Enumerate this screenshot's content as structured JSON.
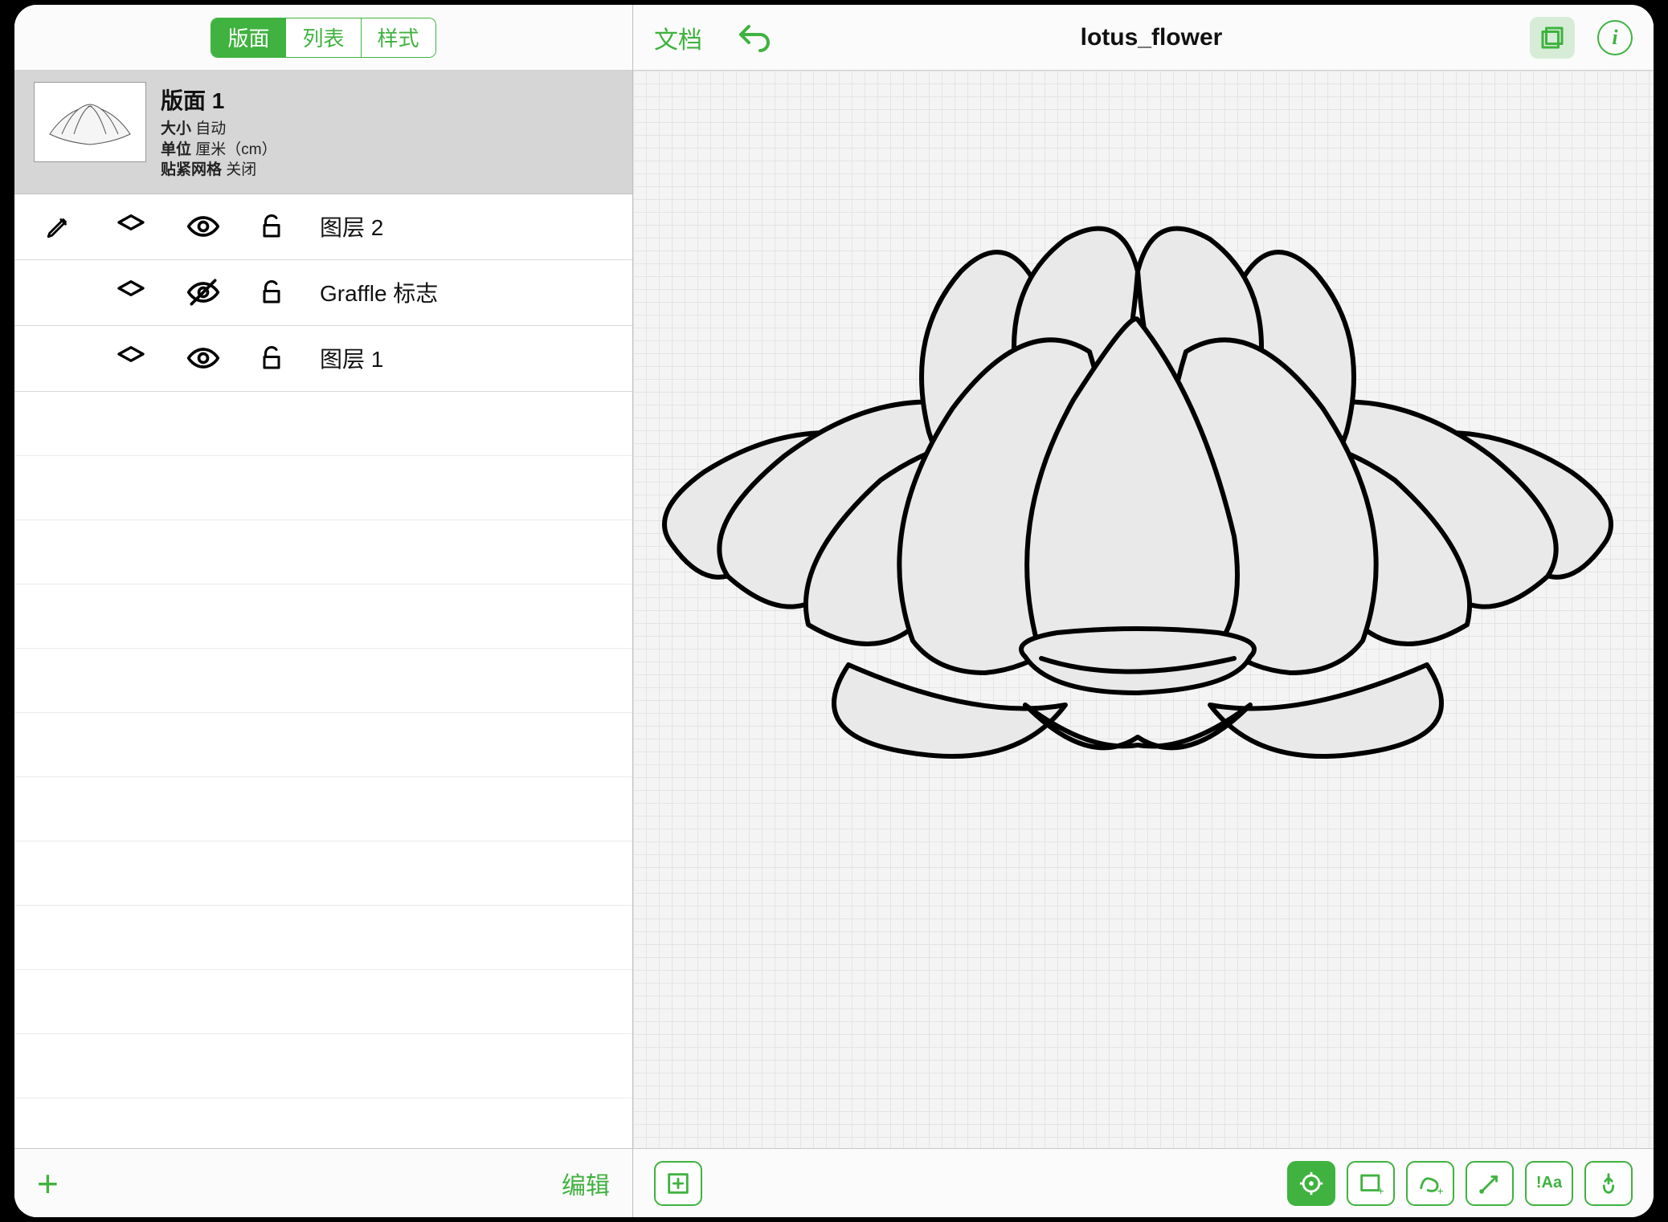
{
  "sidebar": {
    "tabs": [
      {
        "label": "版面",
        "active": true
      },
      {
        "label": "列表",
        "active": false
      },
      {
        "label": "样式",
        "active": false
      }
    ],
    "canvas": {
      "title": "版面 1",
      "size_label": "大小",
      "size_value": "自动",
      "units_label": "单位",
      "units_value": "厘米（cm）",
      "snap_label": "贴紧网格",
      "snap_value": "关闭"
    },
    "layers": [
      {
        "name": "图层 2",
        "visible": true,
        "editable": true
      },
      {
        "name": "Graffle 标志",
        "visible": false,
        "editable": false
      },
      {
        "name": "图层 1",
        "visible": true,
        "editable": false
      }
    ],
    "add_label": "+",
    "edit_label": "编辑"
  },
  "toolbar": {
    "documents_label": "文档",
    "title": "lotus_flower"
  },
  "tools": {
    "add_shape": "add-shape",
    "selection": "selection",
    "rectangle": "rectangle",
    "freehand": "freehand",
    "line": "line",
    "text": "!Aa",
    "touch": "touch"
  },
  "colors": {
    "accent": "#3fb23f"
  }
}
